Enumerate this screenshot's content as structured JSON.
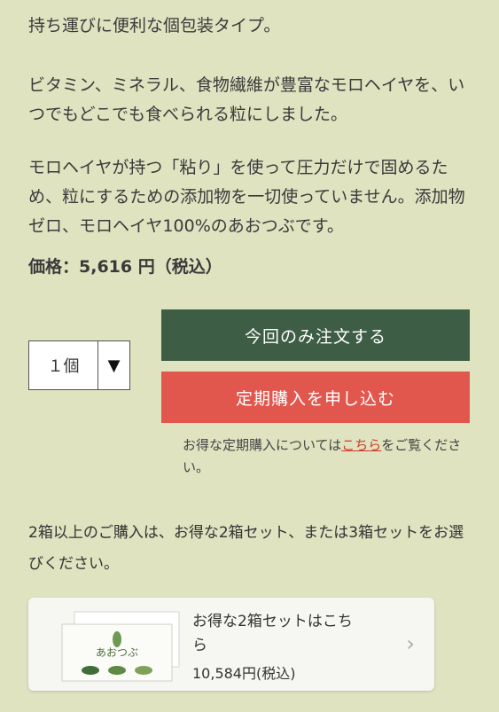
{
  "intro": "持ち運びに便利な個包装タイプ。",
  "desc1": "ビタミン、ミネラル、食物繊維が豊富なモロヘイヤを、いつでもどこでも食べられる粒にしました。",
  "desc2": "モロヘイヤが持つ「粘り」を使って圧力だけで固めるため、粒にするための添加物を一切使っていません。添加物ゼロ、モロヘイヤ100%のあおつぶです。",
  "price": "価格：5,616 円（税込）",
  "quantity": {
    "value": "１個",
    "arrow": "▼"
  },
  "buttons": {
    "order": "今回のみ注文する",
    "subscribe": "定期購入を申し込む"
  },
  "note": {
    "before": "お得な定期購入については",
    "link": "こちら",
    "after": "をご覧ください。"
  },
  "multi_text": "2箱以上のご購入は、お得な2箱セット、または3箱セットをお選びください。",
  "card": {
    "title": "お得な2箱セットはこちら",
    "price": "10,584円(税込)",
    "brand": "あおつぶ",
    "chevron": "›"
  },
  "colors": {
    "background": "#dfe3c0",
    "order": "#3e5d45",
    "subscribe": "#e2574d",
    "link": "#d23a2a"
  }
}
